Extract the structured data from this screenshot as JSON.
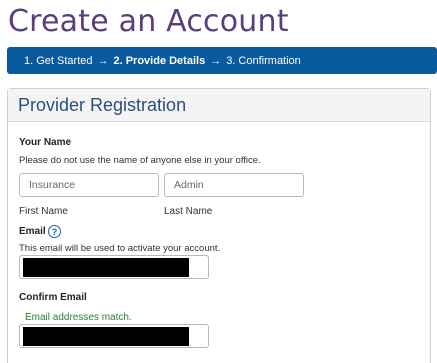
{
  "page": {
    "title": "Create an Account"
  },
  "steps": [
    {
      "label": "1. Get Started",
      "arrow": "→"
    },
    {
      "label": "2. Provide Details",
      "arrow": "→"
    },
    {
      "label": "3. Confirmation",
      "arrow": ""
    }
  ],
  "panel": {
    "title": "Provider Registration"
  },
  "name_section": {
    "label": "Your Name",
    "help": "Please do not use the name of anyone else in your office.",
    "first_value": "Insurance",
    "first_label": "First Name",
    "last_value": "Admin",
    "last_label": "Last Name"
  },
  "email_section": {
    "label": "Email",
    "info_icon": "?",
    "help": "This email will be used to activate your account."
  },
  "confirm_section": {
    "label": "Confirm Email",
    "status": "Email addresses match."
  },
  "colors": {
    "title": "#5b3f7a",
    "steps_bar": "#0a5aa0",
    "panel_title": "#2a4e7e",
    "match_text": "#2e7d32"
  }
}
